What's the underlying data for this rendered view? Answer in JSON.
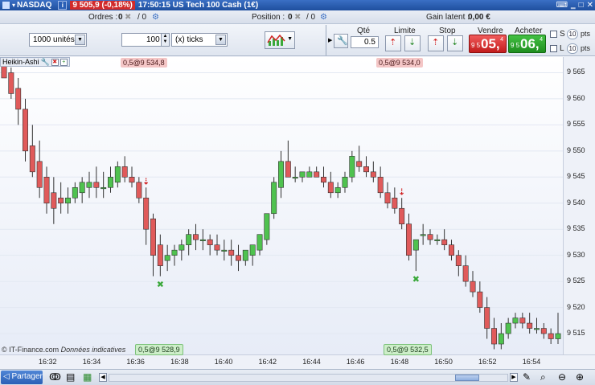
{
  "titlebar": {
    "symbol": "NASDAQ",
    "change": "9 505,9 (-0,18%)",
    "time_title": "17:50:15 US Tech 100 Cash (1€)"
  },
  "statusbar": {
    "orders_label": "Ordres :",
    "orders_count": "0",
    "orders_slash": "/ 0",
    "position_label": "Position :",
    "position_count": "0",
    "position_slash": "/ 0",
    "pnl_label": "Gain latent :",
    "pnl_value": "0,00 €"
  },
  "toolbar": {
    "quantity_units": "1000 unités",
    "tick_value": "100",
    "tick_unit": "(x) ticks",
    "qty_label": "Qté",
    "qty_value": "0.5",
    "limit_label": "Limite",
    "stop_label": "Stop",
    "sell_label": "Vendre",
    "buy_label": "Acheter",
    "sell_small": "9 5",
    "sell_big": "05,",
    "sell_sup": "4",
    "buy_small": "9 5",
    "buy_big": "06,",
    "buy_sup": "4",
    "s_label": "S",
    "l_label": "L",
    "pts_value": "10",
    "pts_label": "pts"
  },
  "chart": {
    "indicator": "Heikin-Ashi",
    "level_top_left": "0,5@9 534,8",
    "level_top_right": "0,5@9 534,0",
    "level_bottom_left": "0,5@9 528,9",
    "level_bottom_right": "0,5@9 532,5",
    "copyright": "© IT-Finance.com",
    "disclaimer": "Données indicatives"
  },
  "chart_data": {
    "type": "candlestick",
    "y_ticks": [
      "9 565",
      "9 560",
      "9 555",
      "9 550",
      "9 545",
      "9 540",
      "9 535",
      "9 530",
      "9 525",
      "9 520",
      "9 515"
    ],
    "x_ticks": [
      "16:32",
      "16:34",
      "16:36",
      "16:38",
      "16:40",
      "16:42",
      "16:44",
      "16:46",
      "16:48",
      "16:50",
      "16:52",
      "16:54"
    ],
    "ylim": [
      9511,
      9568
    ],
    "colors": {
      "up": "#4fc24f",
      "down": "#e05a5a"
    },
    "candles": [
      [
        9567,
        9568,
        9566,
        9564
      ],
      [
        9565,
        9566,
        9560,
        9561
      ],
      [
        9562,
        9564,
        9555,
        9558
      ],
      [
        9558,
        9560,
        9548,
        9550
      ],
      [
        9551,
        9555,
        9545,
        9546
      ],
      [
        9548,
        9552,
        9541,
        9543
      ],
      [
        9545,
        9547,
        9538,
        9540
      ],
      [
        9542,
        9545,
        9536,
        9539
      ],
      [
        9541,
        9544,
        9538,
        9540
      ],
      [
        9540,
        9543,
        9538,
        9541
      ],
      [
        9541,
        9544,
        9540,
        9543
      ],
      [
        9542,
        9545,
        9540,
        9544
      ],
      [
        9543,
        9546,
        9541,
        9544
      ],
      [
        9544,
        9547,
        9541,
        9543
      ],
      [
        9543,
        9546,
        9541,
        9543
      ],
      [
        9543,
        9547,
        9542,
        9545
      ],
      [
        9544,
        9548,
        9543,
        9547
      ],
      [
        9547,
        9549,
        9544,
        9545
      ],
      [
        9545,
        9547,
        9543,
        9544
      ],
      [
        9544,
        9545,
        9540,
        9541
      ],
      [
        9541,
        9543,
        9532,
        9535
      ],
      [
        9537,
        9538,
        9526,
        9530
      ],
      [
        9532,
        9534,
        9526,
        9528
      ],
      [
        9529,
        9532,
        9527,
        9530
      ],
      [
        9530,
        9532,
        9528,
        9531
      ],
      [
        9531,
        9533,
        9529,
        9532
      ],
      [
        9532,
        9535,
        9530,
        9534
      ],
      [
        9534,
        9536,
        9531,
        9533
      ],
      [
        9533,
        9535,
        9531,
        9533
      ],
      [
        9533,
        9534,
        9530,
        9532
      ],
      [
        9532,
        9534,
        9530,
        9531
      ],
      [
        9531,
        9533,
        9529,
        9531
      ],
      [
        9531,
        9533,
        9528,
        9530
      ],
      [
        9530,
        9532,
        9527,
        9529
      ],
      [
        9529,
        9531,
        9528,
        9531
      ],
      [
        9530,
        9532,
        9528,
        9532
      ],
      [
        9531,
        9534,
        9530,
        9534
      ],
      [
        9533,
        9538,
        9532,
        9538
      ],
      [
        9538,
        9545,
        9537,
        9544
      ],
      [
        9543,
        9550,
        9541,
        9548
      ],
      [
        9548,
        9552,
        9545,
        9545
      ],
      [
        9545,
        9547,
        9544,
        9545
      ],
      [
        9545,
        9546,
        9544,
        9546
      ],
      [
        9545,
        9547,
        9545,
        9546
      ],
      [
        9546,
        9547,
        9545,
        9545
      ],
      [
        9545,
        9547,
        9543,
        9544
      ],
      [
        9544,
        9546,
        9541,
        9542
      ],
      [
        9542,
        9544,
        9541,
        9543
      ],
      [
        9543,
        9546,
        9542,
        9545
      ],
      [
        9545,
        9550,
        9544,
        9549
      ],
      [
        9548,
        9551,
        9546,
        9547
      ],
      [
        9547,
        9549,
        9545,
        9546
      ],
      [
        9546,
        9548,
        9544,
        9545
      ],
      [
        9545,
        9547,
        9541,
        9542
      ],
      [
        9542,
        9544,
        9539,
        9540
      ],
      [
        9541,
        9543,
        9538,
        9539
      ],
      [
        9539,
        9541,
        9535,
        9536
      ],
      [
        9536,
        9538,
        9529,
        9530
      ],
      [
        9531,
        9533,
        9527,
        9533
      ],
      [
        9534,
        9536,
        9532,
        9534
      ],
      [
        9534,
        9535,
        9532,
        9533
      ],
      [
        9533,
        9534,
        9532,
        9533
      ],
      [
        9533,
        9535,
        9531,
        9532
      ],
      [
        9532,
        9533,
        9529,
        9530
      ],
      [
        9530,
        9531,
        9526,
        9528
      ],
      [
        9528,
        9530,
        9524,
        9525
      ],
      [
        9525,
        9527,
        9522,
        9523
      ],
      [
        9523,
        9525,
        9519,
        9520
      ],
      [
        9520,
        9522,
        9514,
        9516
      ],
      [
        9516,
        9518,
        9512,
        9513
      ],
      [
        9513,
        9517,
        9512,
        9515
      ],
      [
        9515,
        9518,
        9514,
        9517
      ],
      [
        9517,
        9519,
        9516,
        9518
      ],
      [
        9518,
        9519,
        9516,
        9517
      ],
      [
        9517,
        9519,
        9515,
        9516
      ],
      [
        9516,
        9518,
        9515,
        9516
      ],
      [
        9516,
        9517,
        9514,
        9515
      ],
      [
        9515,
        9516,
        9513,
        9514
      ],
      [
        9514,
        9519,
        9513,
        9515
      ]
    ]
  },
  "bottombar": {
    "share_label": "Partager"
  }
}
